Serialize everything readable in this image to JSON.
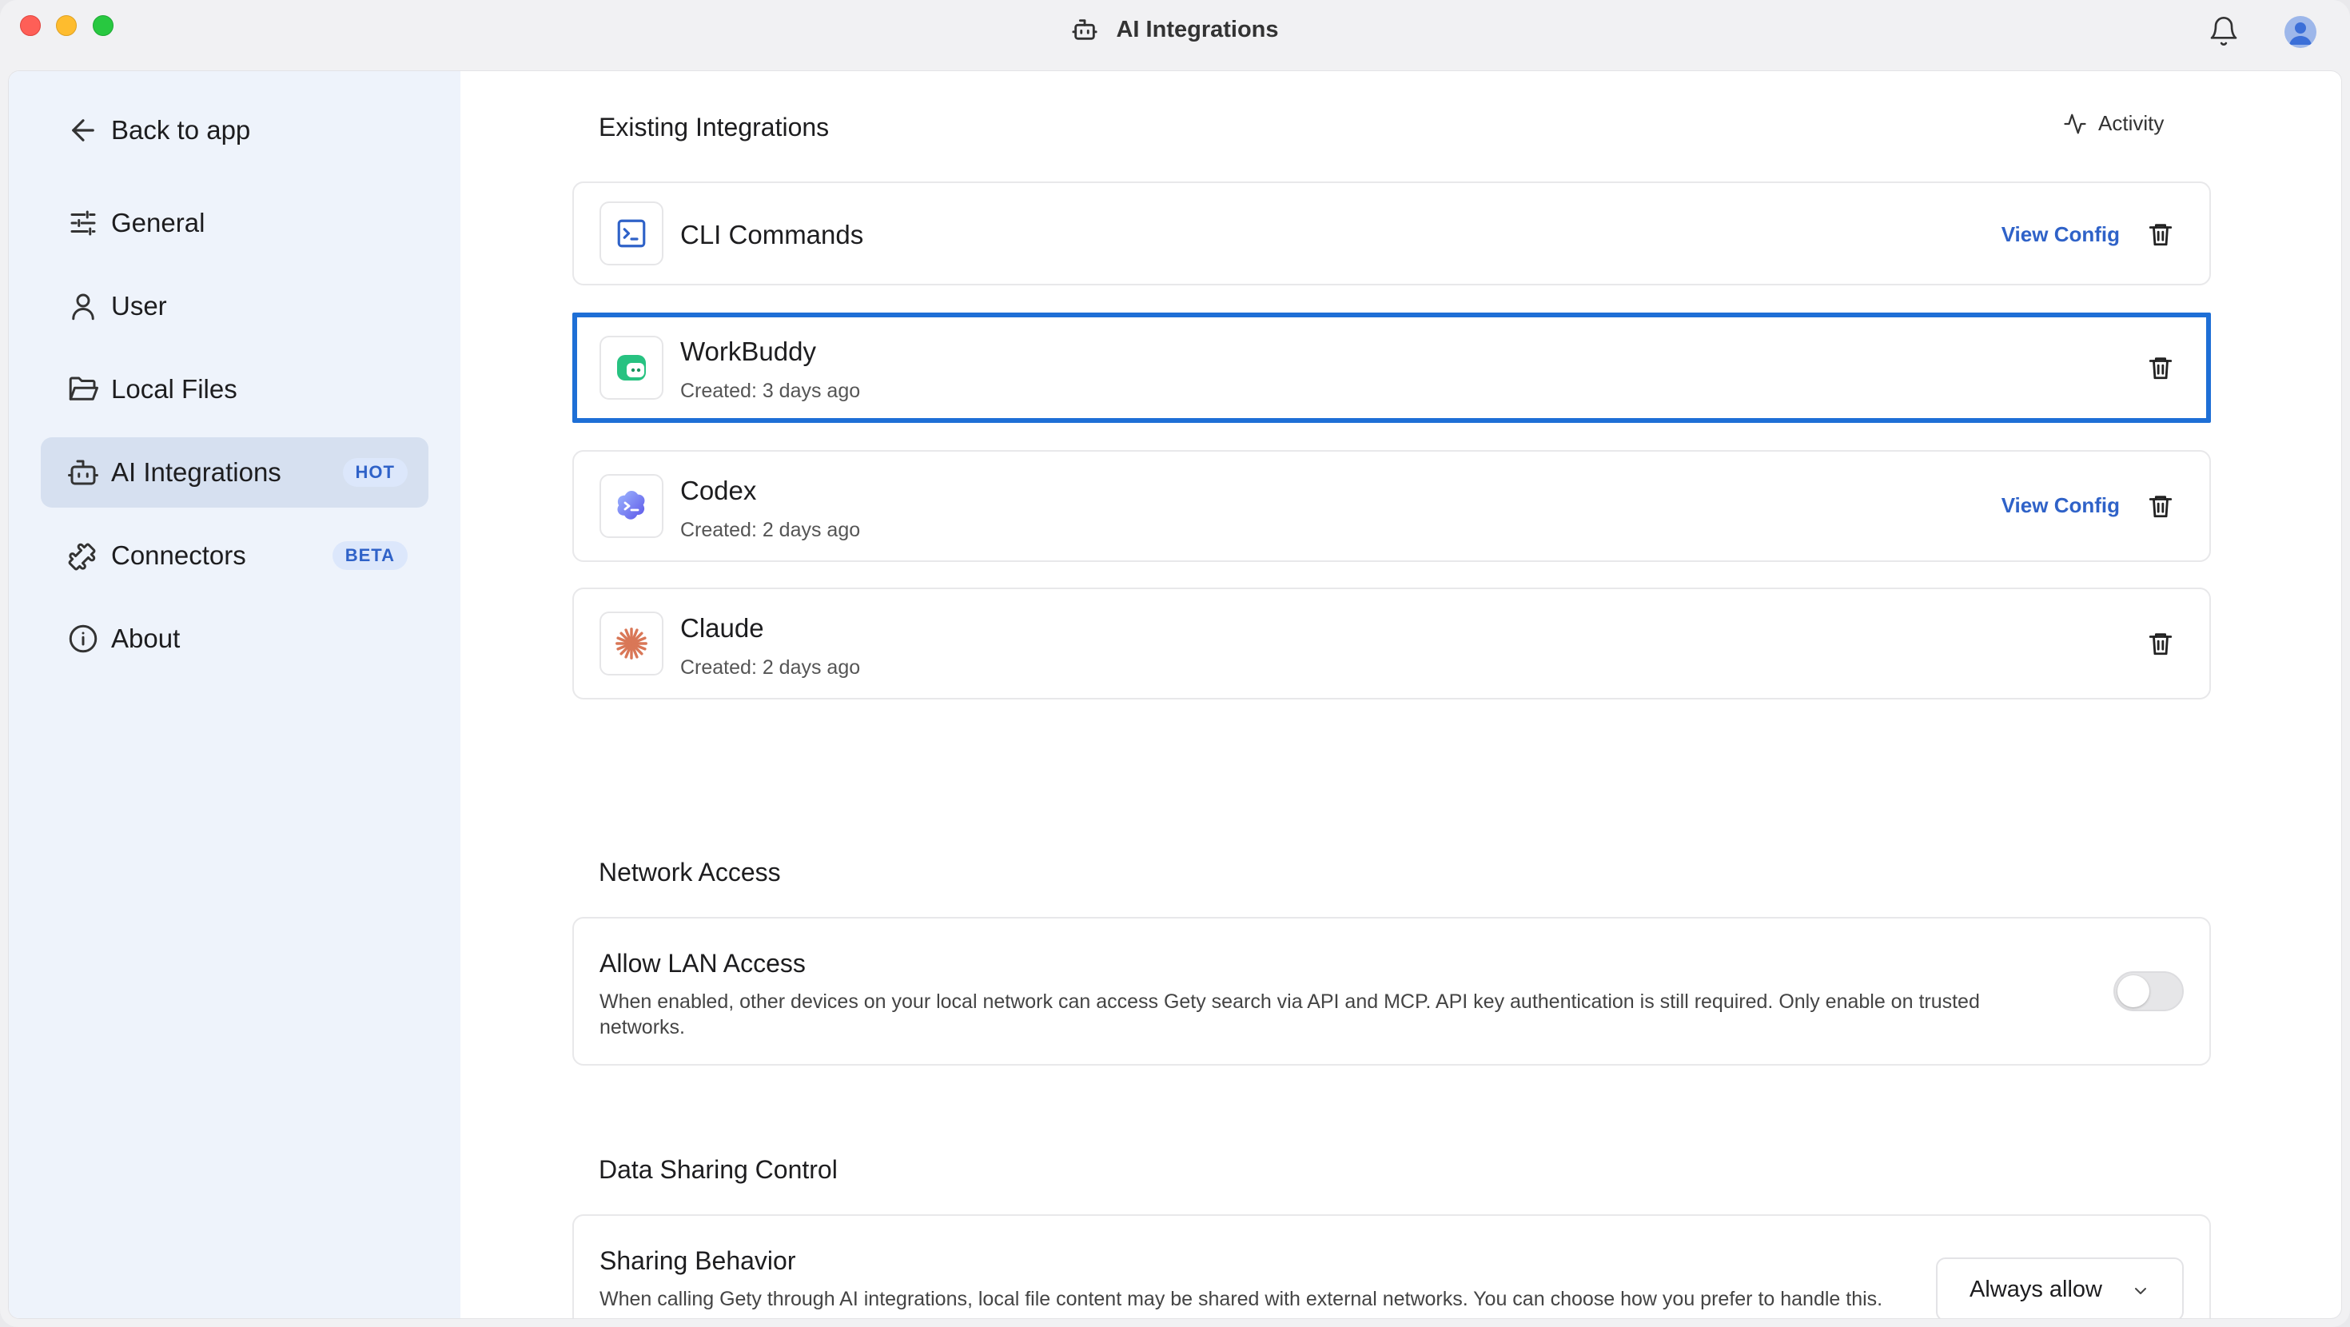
{
  "window": {
    "title": "AI Integrations"
  },
  "sidebar": {
    "back_label": "Back to app",
    "items": [
      {
        "label": "General"
      },
      {
        "label": "User"
      },
      {
        "label": "Local Files"
      },
      {
        "label": "AI Integrations",
        "badge": "HOT",
        "active": true
      },
      {
        "label": "Connectors",
        "badge": "BETA"
      },
      {
        "label": "About"
      }
    ]
  },
  "integrations": {
    "section_title": "Existing Integrations",
    "activity_label": "Activity",
    "items": [
      {
        "name": "CLI Commands",
        "action": "View Config"
      },
      {
        "name": "WorkBuddy",
        "created": "Created: 3 days ago"
      },
      {
        "name": "Codex",
        "created": "Created: 2 days ago",
        "action": "View Config"
      },
      {
        "name": "Claude",
        "created": "Created: 2 days ago"
      }
    ]
  },
  "network": {
    "section_title": "Network Access",
    "setting_title": "Allow LAN Access",
    "description": "When enabled, other devices on your local network can access Gety search via API and MCP. API key authentication is still required. Only enable on trusted networks.",
    "enabled": false
  },
  "data_sharing": {
    "section_title": "Data Sharing Control",
    "setting_title": "Sharing Behavior",
    "description": "When calling Gety through AI integrations, local file content may be shared with external networks. You can choose how you prefer to handle this.",
    "selected": "Always allow"
  },
  "colors": {
    "accent": "#1e6fd6",
    "link": "#2f62c8",
    "sidebar_bg": "#eef3fb",
    "active_bg": "#d6e0f0"
  }
}
